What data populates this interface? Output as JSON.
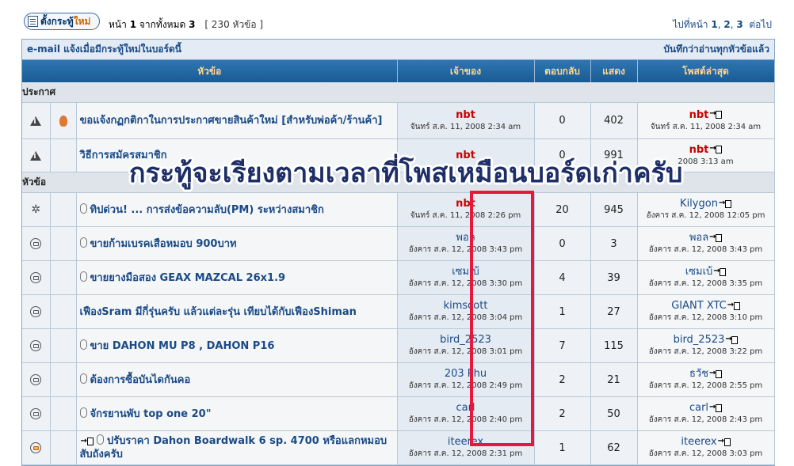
{
  "toolbar": {
    "new_topic_label_a": "ตั้งกระทู้",
    "new_topic_label_b": "ใหม่",
    "page_label": "หน้า",
    "page_current": "1",
    "page_of": "จากทั้งหมด",
    "page_total": "3",
    "topic_count": "[ 230 หัวข้อ ]",
    "goto_label": "ไปที่หน้า",
    "pages": [
      "1",
      "2",
      "3"
    ],
    "next_label": "ต่อไป"
  },
  "links": {
    "email_notify": "e-mail แจ้งเมื่อมีกระทู้ใหม่ในบอร์ดนี้",
    "mark_read": "บันทึกว่าอ่านทุกหัวข้อแล้ว"
  },
  "columns": {
    "topic": "หัวข้อ",
    "owner": "เจ้าของ",
    "replies": "ตอบกลับ",
    "views": "แสดง",
    "last_post": "โพสต์ล่าสุด"
  },
  "sections": {
    "announcements": "ประกาศ",
    "topics": "หัวข้อ"
  },
  "announcements": [
    {
      "title": "ขอแจ้งกฏกติกาในการประกาศขายสินค้าใหม่ [สำหรับพ่อค้า/ร้านค้า]",
      "author": "nbt",
      "author_time": "จันทร์ ส.ค. 11, 2008 2:34 am",
      "replies": "0",
      "views": "402",
      "last_user": "nbt",
      "last_time": "จันทร์ ส.ค. 11, 2008 2:34 am"
    },
    {
      "title": "วิธีการสมัครสมาชิก",
      "author": "nbt",
      "author_time": "",
      "replies": "0",
      "views": "991",
      "last_user": "nbt",
      "last_time": "2008 3:13 am"
    }
  ],
  "topics": [
    {
      "title": "ทิปด่วน! ... การส่งข้อความลับ(PM) ระหว่างสมาชิก",
      "author": "nbt",
      "author_time": "จันทร์ ส.ค. 11, 2008 2:26 pm",
      "replies": "20",
      "views": "945",
      "last_user": "Kilygon",
      "last_time": "อังคาร ส.ค. 12, 2008 12:05 pm"
    },
    {
      "title": "ขายก้ามเบรคเสือหมอบ 900บาท",
      "author": "พอล",
      "author_time": "อังคาร ส.ค. 12, 2008 3:43 pm",
      "replies": "0",
      "views": "3",
      "last_user": "พอล",
      "last_time": "อังคาร ส.ค. 12, 2008 3:43 pm"
    },
    {
      "title": "ขายยางมือสอง GEAX MAZCAL 26x1.9",
      "author": "เซมเบ้",
      "author_time": "อังคาร ส.ค. 12, 2008 3:30 pm",
      "replies": "4",
      "views": "39",
      "last_user": "เซมเบ้",
      "last_time": "อังคาร ส.ค. 12, 2008 3:35 pm"
    },
    {
      "title": "เฟืองSram มีกี่รุ่นครับ แล้วแต่ละรุ่น เทียบได้กับเฟืองShiman",
      "author": "kimscott",
      "author_time": "อังคาร ส.ค. 12, 2008 3:04 pm",
      "replies": "1",
      "views": "27",
      "last_user": "GIANT XTC",
      "last_time": "อังคาร ส.ค. 12, 2008 3:10 pm"
    },
    {
      "title": "ขาย DAHON MU P8 , DAHON P16",
      "author": "bird_2523",
      "author_time": "อังคาร ส.ค. 12, 2008 3:01 pm",
      "replies": "7",
      "views": "115",
      "last_user": "bird_2523",
      "last_time": "อังคาร ส.ค. 12, 2008 3:22 pm"
    },
    {
      "title": "ต้องการซื้อบันไดกันคอ",
      "author": "203 Phu",
      "author_time": "อังคาร ส.ค. 12, 2008 2:49 pm",
      "replies": "2",
      "views": "21",
      "last_user": "ธวัช",
      "last_time": "อังคาร ส.ค. 12, 2008 2:55 pm"
    },
    {
      "title": "จักรยานพับ top one 20\"",
      "author": "carl",
      "author_time": "อังคาร ส.ค. 12, 2008 2:40 pm",
      "replies": "2",
      "views": "50",
      "last_user": "carl",
      "last_time": "อังคาร ส.ค. 12, 2008 2:43 pm"
    },
    {
      "title": "ปรับราคา Dahon Boardwalk 6 sp. 4700 หรือแลกหมอบ สับถังครับ",
      "author": "iteerex",
      "author_time": "อังคาร ส.ค. 12, 2008 2:31 pm",
      "replies": "1",
      "views": "62",
      "last_user": "iteerex",
      "last_time": "อังคาร ส.ค. 12, 2008 3:03 pm"
    }
  ],
  "overlay_caption": "กระทู้จะเรียงตามเวลาที่โพสเหมือนบอร์ดเก่าครับ",
  "colors": {
    "header_blue": "#1a5a93",
    "header_text": "#ffd88a",
    "link_blue": "#1a4a86",
    "admin_red": "#cc0000",
    "highlight_red": "#e8183c"
  }
}
